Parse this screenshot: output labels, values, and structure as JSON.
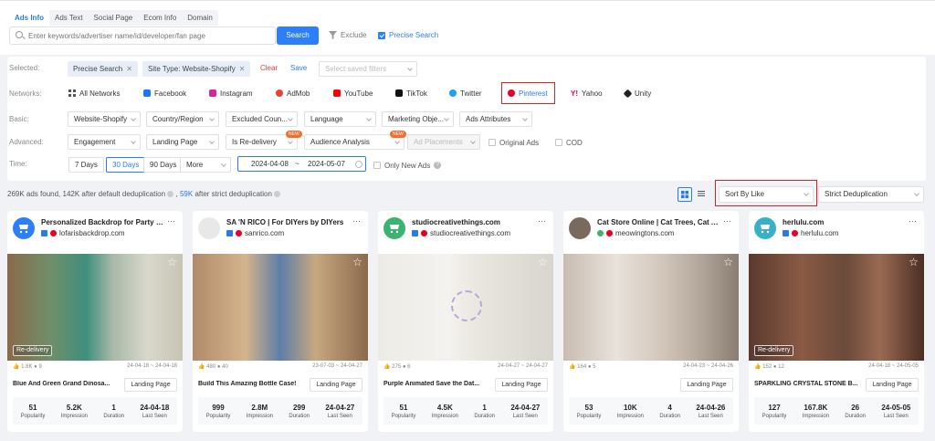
{
  "tabs": [
    {
      "label": "Ads Info",
      "active": true
    },
    {
      "label": "Ads Text"
    },
    {
      "label": "Social Page"
    },
    {
      "label": "Ecom Info"
    },
    {
      "label": "Domain"
    }
  ],
  "search": {
    "placeholder": "Enter keywords/advertiser name/id/developer/fan page",
    "button": "Search",
    "exclude": "Exclude",
    "precise": "Precise Search"
  },
  "selected": {
    "label": "Selected:",
    "chips": [
      "Precise Search",
      "Site Type: Website-Shopify"
    ],
    "clear": "Clear",
    "save": "Save",
    "saved_placeholder": "Select saved filters"
  },
  "networks": {
    "label": "Networks:",
    "items": [
      {
        "label": "All Networks",
        "icon": "grid-icon",
        "color": "#555555"
      },
      {
        "label": "Facebook",
        "icon": "facebook-icon",
        "color": "#1877f2"
      },
      {
        "label": "Instagram",
        "icon": "instagram-icon",
        "color": "#d6249f"
      },
      {
        "label": "AdMob",
        "icon": "admob-icon",
        "color": "#ea4335"
      },
      {
        "label": "YouTube",
        "icon": "youtube-icon",
        "color": "#ff0000"
      },
      {
        "label": "TikTok",
        "icon": "tiktok-icon",
        "color": "#111111"
      },
      {
        "label": "Twitter",
        "icon": "twitter-icon",
        "color": "#1da1f2"
      },
      {
        "label": "Pinterest",
        "icon": "pinterest-icon",
        "color": "#e60023"
      },
      {
        "label": "Yahoo",
        "icon": "yahoo-icon",
        "color": "#e0005e"
      },
      {
        "label": "Unity",
        "icon": "unity-icon",
        "color": "#222222"
      }
    ]
  },
  "basic": {
    "label": "Basic:",
    "selects": [
      "Website-Shopify",
      "Country/Region",
      "Excluded Coun...",
      "Language",
      "Marketing Obje...",
      "Ads Attributes"
    ]
  },
  "advanced": {
    "label": "Advanced:",
    "selects": [
      "Engagement",
      "Landing Page",
      "Is Re-delivery",
      "Audience Analysis",
      "Ad Placements"
    ],
    "new_badge": "NEW",
    "checkboxes": [
      "Original Ads",
      "COD"
    ]
  },
  "time": {
    "label": "Time:",
    "buttons": [
      "7 Days",
      "30 Days",
      "90 Days"
    ],
    "more": "More",
    "start": "2024-04-08",
    "sep": "~",
    "end": "2024-05-07",
    "only_new": "Only New Ads"
  },
  "summary": {
    "part1": "269K ads found, 142K after default deduplication",
    "part2": "59K",
    "part3": "after strict deduplication"
  },
  "sort": {
    "label": "Sort By Like"
  },
  "dedup": {
    "label": "Strict Deduplication"
  },
  "cards": [
    {
      "advertiser": "Personalized Backdrop for Party an...",
      "domain": "lofarisbackdrop.com",
      "redelivery": "Re-delivery",
      "likes": "1.8K",
      "comments": "9",
      "dates": "24-04-18 ~ 24-04-18",
      "title": "Blue And Green Grand Dinosa...",
      "landing": "Landing Page",
      "popularity": "51",
      "impression": "5.2K",
      "duration": "1",
      "last_seen": "24-04-18"
    },
    {
      "advertiser": "SA 'N RICO | For DIYers by DIYers",
      "domain": "sanrico.com",
      "redelivery": "",
      "likes": "480",
      "comments": "40",
      "dates": "23-07-03 ~ 24-04-27",
      "title": "Build This Amazing Bottle Case!",
      "landing": "Landing Page",
      "popularity": "999",
      "impression": "2.8M",
      "duration": "299",
      "last_seen": "24-04-27"
    },
    {
      "advertiser": "studiocreativethings.com",
      "domain": "studiocreativethings.com",
      "redelivery": "",
      "likes": "275",
      "comments": "6",
      "dates": "24-04-27 ~ 24-04-27",
      "title": "Purple Animated Save the Dat...",
      "landing": "Landing Page",
      "popularity": "51",
      "impression": "4.5K",
      "duration": "1",
      "last_seen": "24-04-27"
    },
    {
      "advertiser": "Cat Store Online | Cat Trees, Cat Ap...",
      "domain": "meowingtons.com",
      "redelivery": "",
      "likes": "164",
      "comments": "5",
      "dates": "24-04-23 ~ 24-04-26",
      "title": "",
      "landing": "Landing Page",
      "popularity": "53",
      "impression": "10K",
      "duration": "4",
      "last_seen": "24-04-26"
    },
    {
      "advertiser": "herlulu.com",
      "domain": "herlulu.com",
      "redelivery": "Re-delivery",
      "likes": "152",
      "comments": "12",
      "dates": "24-04-18 ~ 24-05-05",
      "title": "SPARKLING CRYSTAL STONE B...",
      "landing": "Landing Page",
      "popularity": "127",
      "impression": "167.8K",
      "duration": "26",
      "last_seen": "24-05-05"
    }
  ],
  "stat_labels": {
    "popularity": "Popularity",
    "impression": "Impression",
    "duration": "Duration",
    "last_seen": "Last Seen"
  }
}
